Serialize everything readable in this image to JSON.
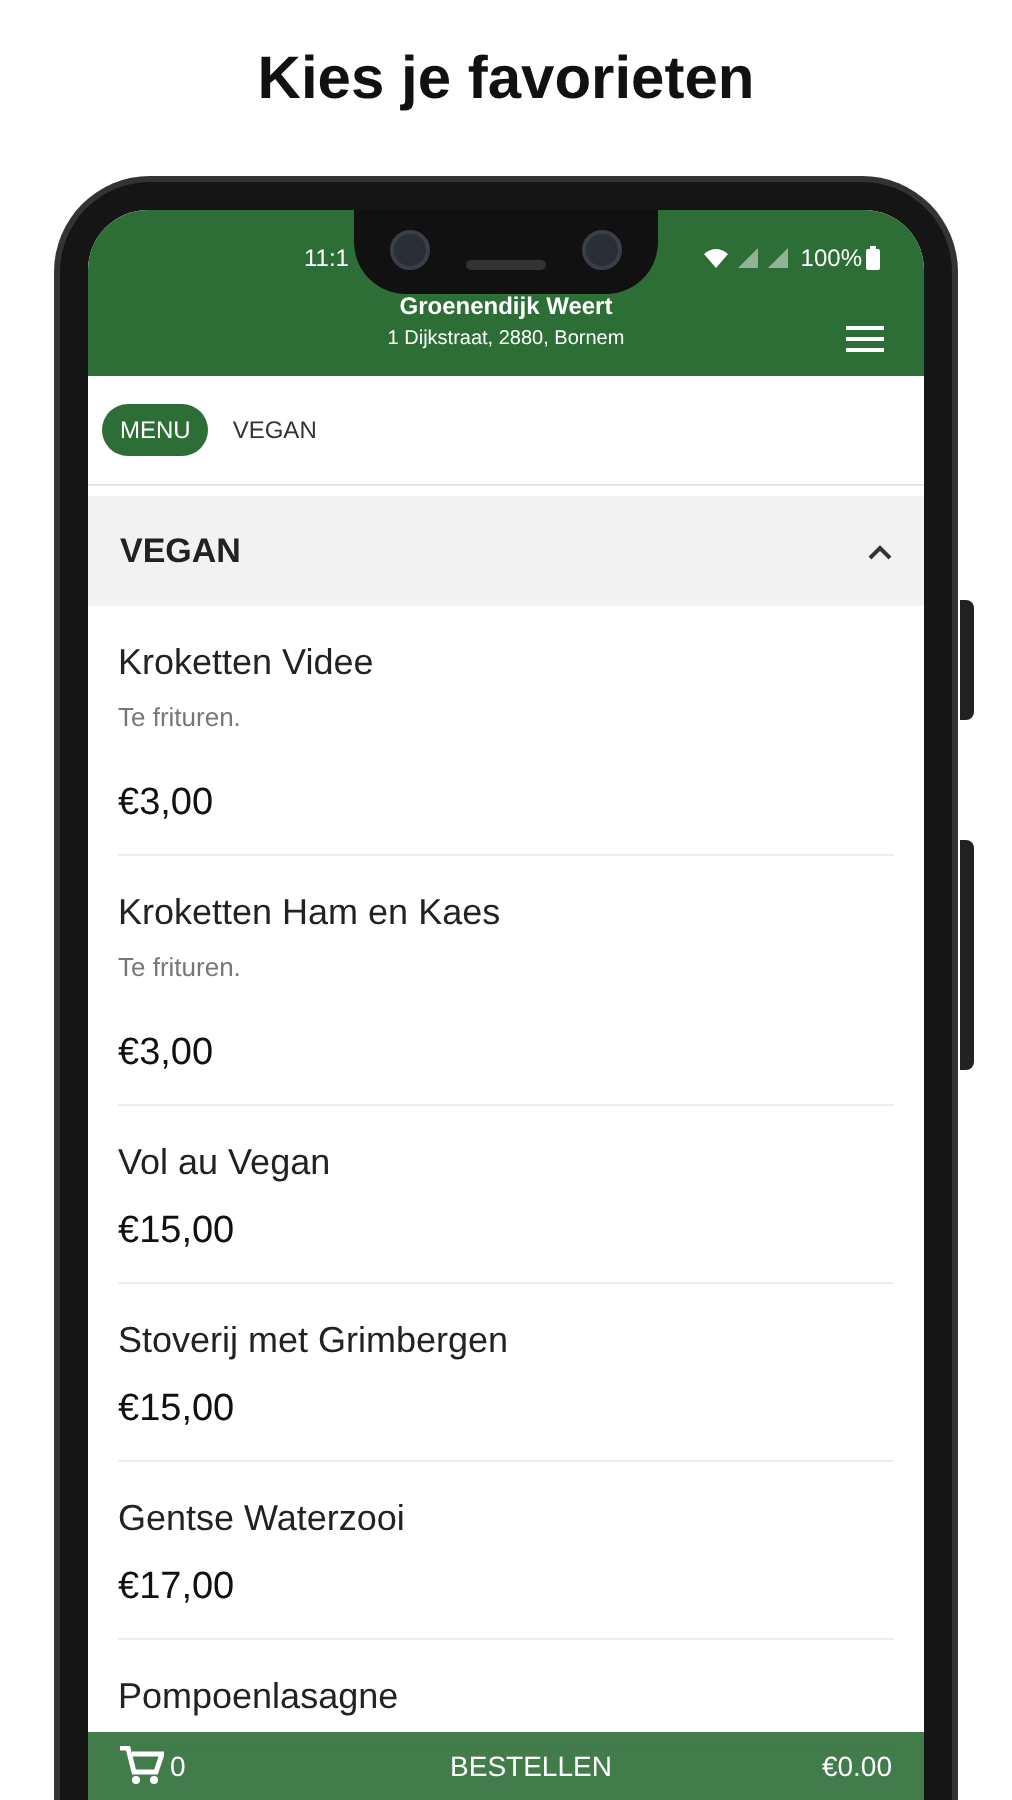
{
  "headline": "Kies je favorieten",
  "status_bar": {
    "time": "11:1",
    "battery": "100%"
  },
  "header": {
    "title": "Groenendijk Weert",
    "address": "1 Dijkstraat, 2880, Bornem"
  },
  "tabs": [
    {
      "label": "MENU",
      "selected": true
    },
    {
      "label": "VEGAN",
      "selected": false
    }
  ],
  "section": {
    "title": "VEGAN",
    "expanded": true
  },
  "items": [
    {
      "name": "Kroketten Videe",
      "description": "Te frituren.",
      "price": "€3,00"
    },
    {
      "name": "Kroketten Ham en Kaes",
      "description": "Te frituren.",
      "price": "€3,00"
    },
    {
      "name": "Vol au Vegan",
      "price": "€15,00"
    },
    {
      "name": "Stoverij met Grimbergen",
      "price": "€15,00"
    },
    {
      "name": "Gentse Waterzooi",
      "price": "€17,00"
    },
    {
      "name": "Pompoenlasagne"
    }
  ],
  "order_bar": {
    "count": "0",
    "button": "BESTELLEN",
    "total": "€0.00"
  }
}
